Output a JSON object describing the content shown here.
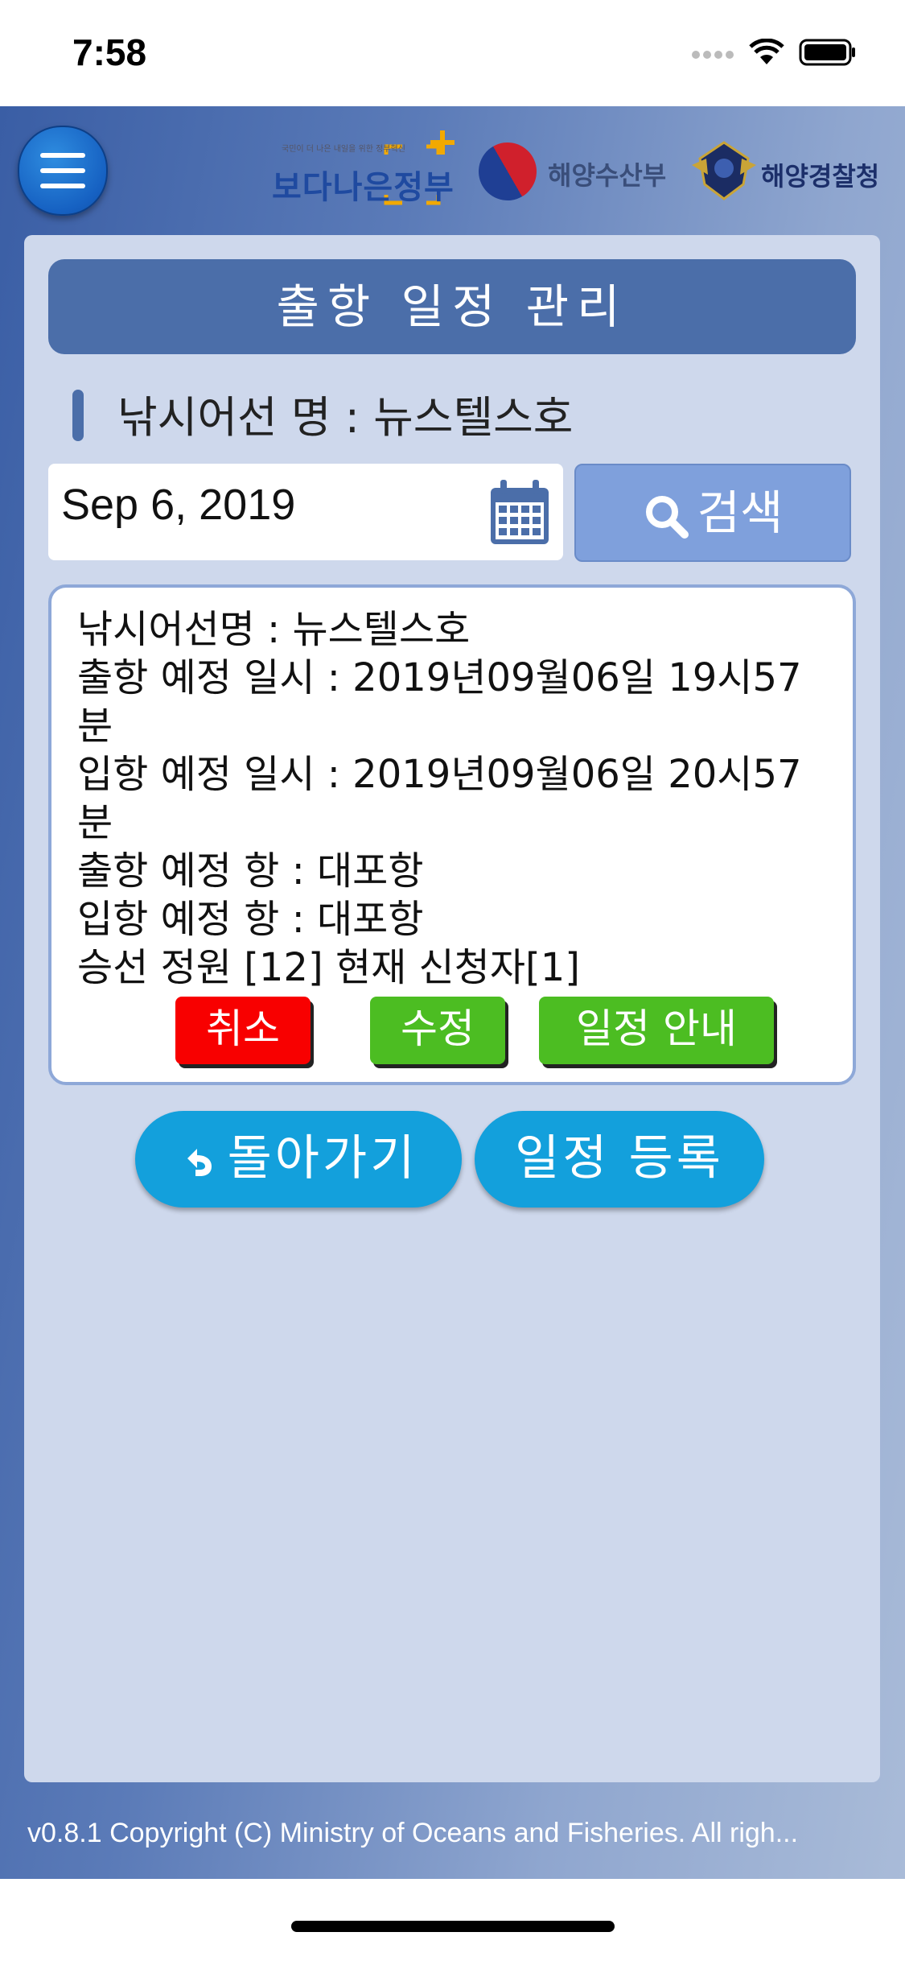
{
  "status": {
    "time": "7:58"
  },
  "header": {
    "logos": {
      "gov_small": "국민이 더 나은 내일을 위한 정부혁신",
      "gov": "보다나은정부",
      "mof": "해양수산부",
      "kcg": "해양경찰청"
    }
  },
  "page": {
    "title": "출항 일정 관리",
    "vessel_label": "낚시어선 명 : 뉴스텔스호"
  },
  "search": {
    "date": "Sep 6, 2019",
    "button": "검색"
  },
  "schedule": {
    "lines": [
      "낚시어선명 : 뉴스텔스호",
      "출항 예정 일시 : 2019년09월06일 19시57분",
      "입항 예정 일시 : 2019년09월06일 20시57분",
      "출항 예정 항 : 대포항",
      "입항 예정 항 : 대포항",
      "승선 정원 [12] 현재 신청자[1]"
    ],
    "actions": {
      "cancel": "취소",
      "edit": "수정",
      "guide": "일정 안내"
    },
    "colors": {
      "cancel": "#f80000",
      "edit": "#4cbd22",
      "guide": "#4cbd22"
    }
  },
  "nav": {
    "back": "돌아가기",
    "register": "일정 등록"
  },
  "footer": {
    "text": "v0.8.1 Copyright (C) Ministry of Oceans and Fisheries. All righ..."
  },
  "icons": {
    "menu": "hamburger-menu-icon",
    "calendar": "calendar-icon",
    "search": "search-icon",
    "back": "undo-arrow-icon"
  }
}
